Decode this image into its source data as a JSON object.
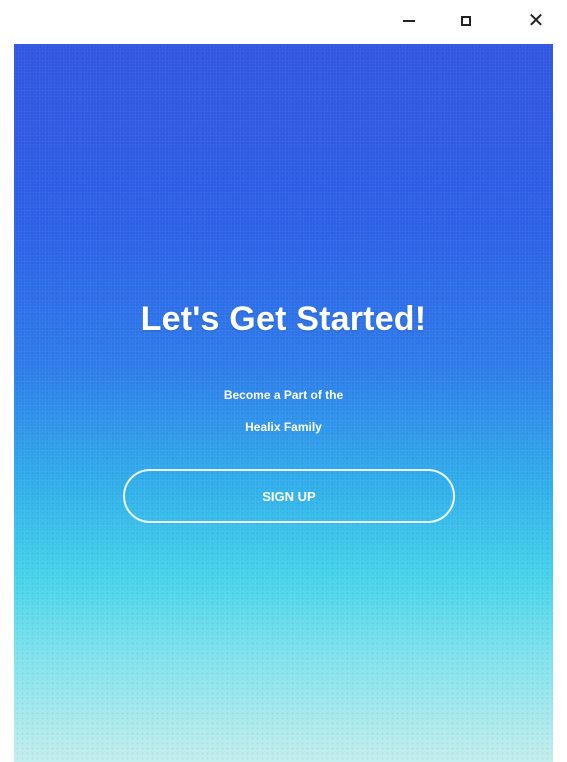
{
  "window_controls": {
    "minimize_icon": "minimize-icon",
    "maximize_icon": "maximize-icon",
    "close_icon": "close-icon",
    "close_glyph": "✕"
  },
  "welcome": {
    "heading": "Let's Get Started!",
    "subtitle_line1": "Become a Part of the",
    "subtitle_line2": "Healix Family",
    "signup_label": "SIGN UP"
  },
  "colors": {
    "gradient_top": "#2f54e2",
    "gradient_bottom": "#c3eeee",
    "text": "#ffffff"
  }
}
